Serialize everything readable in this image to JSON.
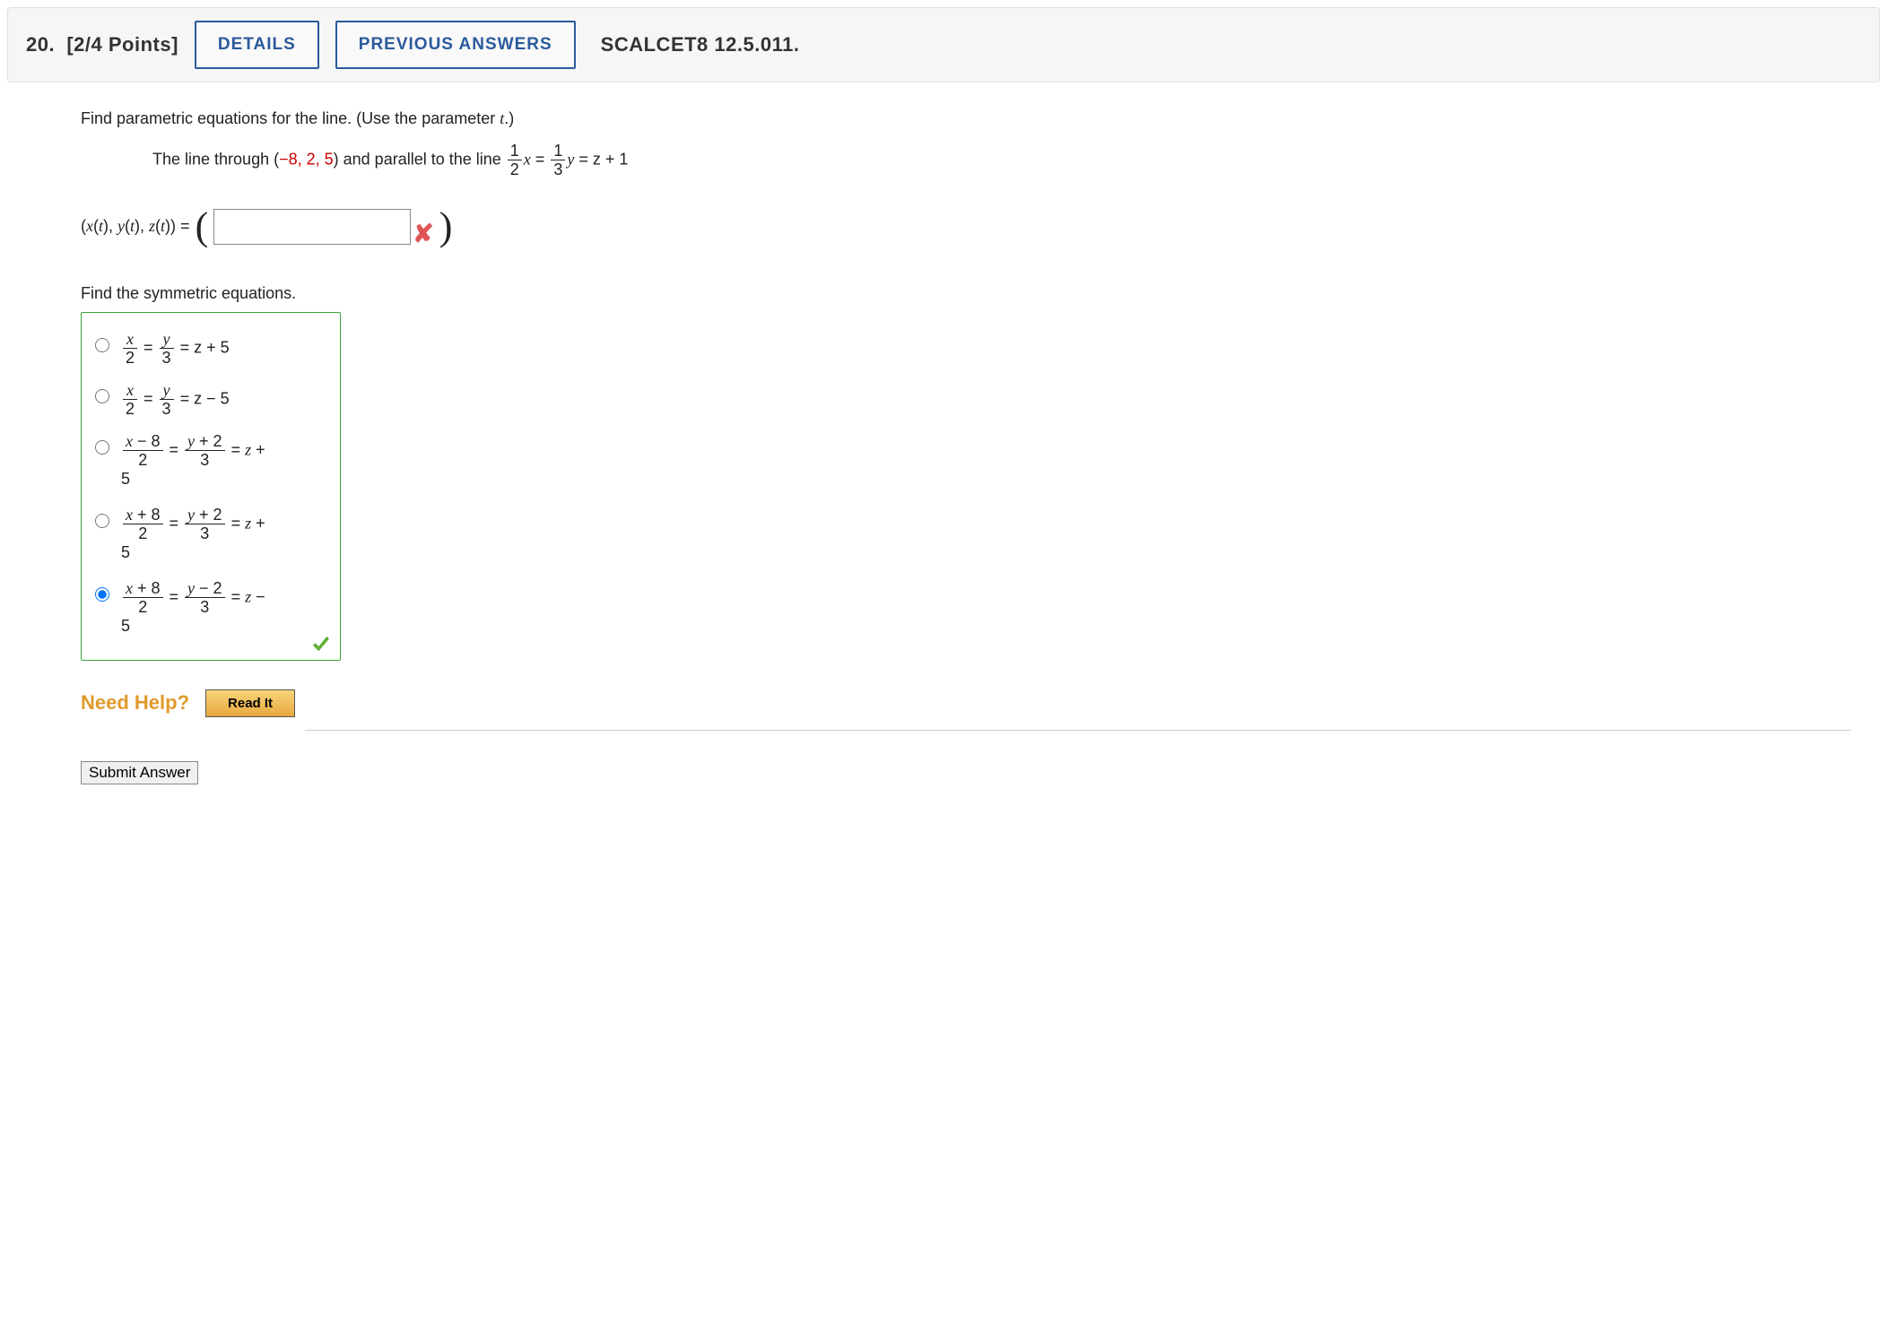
{
  "header": {
    "question_number": "20.",
    "points": "[2/4 Points]",
    "details_btn": "DETAILS",
    "prev_btn": "PREVIOUS ANSWERS",
    "assignment": "SCALCET8 12.5.011."
  },
  "problem": {
    "instruction": "Find parametric equations for the line. (Use the parameter t.)",
    "line_text_a": "The line through  (",
    "point": "−8, 2, 5",
    "line_text_b": ")  and parallel to the line ",
    "eq_tail": " = z + 1",
    "answer_label_a": "(x(t), y(t), z(t)) = ",
    "answer_value": "",
    "sub_instruction": "Find the symmetric equations.",
    "options": [
      {
        "html_a": "x",
        "html_b": "2",
        "html_c": "y",
        "html_d": "3",
        "tail": " = z + 5",
        "style": "simple"
      },
      {
        "html_a": "x",
        "html_b": "2",
        "html_c": "y",
        "html_d": "3",
        "tail": " = z − 5",
        "style": "simple"
      },
      {
        "html_a": "x − 8",
        "html_b": "2",
        "html_c": "y + 2",
        "html_d": "3",
        "tail": " = z + 5",
        "style": "wrap"
      },
      {
        "html_a": "x + 8",
        "html_b": "2",
        "html_c": "y + 2",
        "html_d": "3",
        "tail": " = z + 5",
        "style": "wrap"
      },
      {
        "html_a": "x + 8",
        "html_b": "2",
        "html_c": "y − 2",
        "html_d": "3",
        "tail": " = z − 5",
        "style": "wrap"
      }
    ],
    "selected_index": 4
  },
  "help": {
    "label": "Need Help?",
    "read_btn": "Read It"
  },
  "footer": {
    "submit": "Submit Answer"
  }
}
